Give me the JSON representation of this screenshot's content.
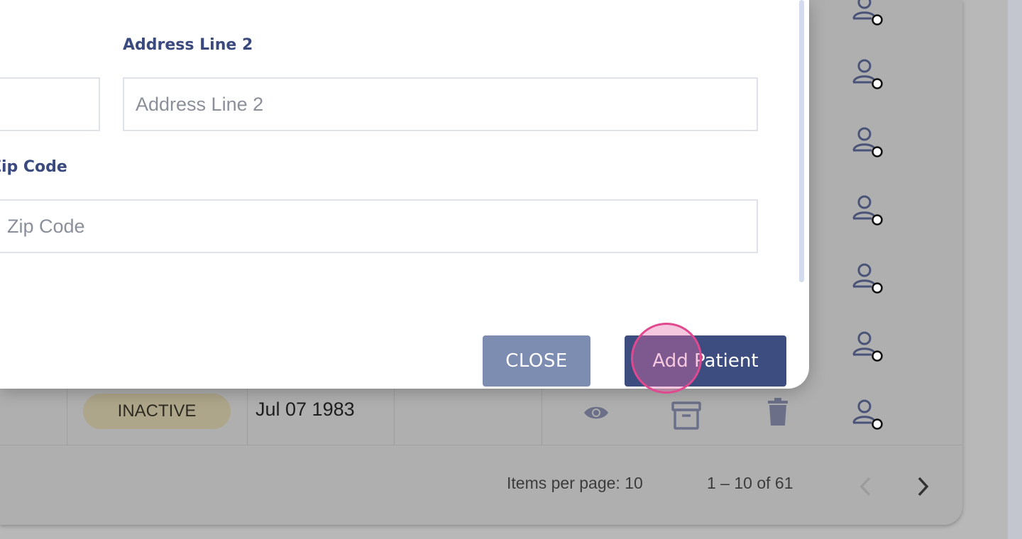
{
  "modal": {
    "address_line2": {
      "label": "Address Line 2",
      "placeholder": "Address Line 2"
    },
    "zip_code": {
      "label": "Zip Code",
      "placeholder": "Zip Code"
    },
    "close_label": "CLOSE",
    "add_label": "Add Patient"
  },
  "table": {
    "row": {
      "status": "INACTIVE",
      "date": "Jul 07 1983"
    },
    "actions": [
      "eye-icon",
      "archive-icon",
      "trash-icon"
    ]
  },
  "paginator": {
    "items_per_page": "Items per page: 10",
    "range": "1 – 10 of 61"
  },
  "sidebar_icons": [
    "user-clock-icon",
    "user-clock-icon",
    "user-clock-icon",
    "user-clock-icon",
    "user-clock-icon",
    "user-clock-icon",
    "user-clock-icon"
  ],
  "colors": {
    "accent": "#3d4d7f",
    "secondary": "#7d8cb1",
    "label": "#3b4a7e",
    "inactive_badge": "#aea68a",
    "click_indicator": "#e0488f"
  }
}
